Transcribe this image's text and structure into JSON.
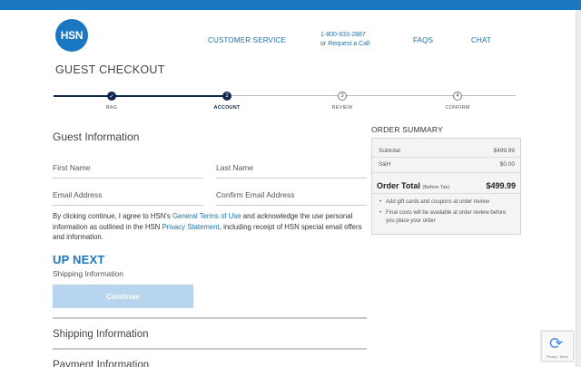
{
  "header": {
    "logo_text": "HSN",
    "customer_service": "CUSTOMER SERVICE",
    "phone_number": "1-800-933-2887",
    "phone_or": "or",
    "request_call": "Request a Call",
    "faqs": "FAQS",
    "chat": "CHAT"
  },
  "page_title": "GUEST CHECKOUT",
  "progress": {
    "steps": [
      {
        "label": "BAG",
        "marker": "✓",
        "state": "complete"
      },
      {
        "label": "ACCOUNT",
        "marker": "2",
        "state": "current"
      },
      {
        "label": "REVIEW",
        "marker": "3",
        "state": "upcoming"
      },
      {
        "label": "CONFIRM",
        "marker": "4",
        "state": "upcoming"
      }
    ]
  },
  "guest_info": {
    "title": "Guest Information",
    "first_name_placeholder": "First Name",
    "last_name_placeholder": "Last Name",
    "email_placeholder": "Email Address",
    "confirm_email_placeholder": "Confirm Email Address"
  },
  "consent": {
    "part1": "By clicking continue, I agree to HSN's ",
    "terms_link": "General Terms of Use",
    "part2": " and acknowledge the use personal information as outlined in the HSN ",
    "privacy_link": "Privacy Statement",
    "part3": ", including receipt of HSN special email offers and information."
  },
  "up_next": {
    "title": "UP NEXT",
    "subtitle": "Shipping Information",
    "button_label": "Continue"
  },
  "collapsed_sections": {
    "shipping": "Shipping Information",
    "payment": "Payment Information"
  },
  "order_summary": {
    "title": "ORDER SUMMARY",
    "subtotal_label": "Subtotal",
    "subtotal_value": "$499.99",
    "sh_label": "S&H",
    "sh_value": "$0.00",
    "total_label": "Order Total",
    "total_note": "(Before Tax)",
    "total_value": "$499.99",
    "notes": [
      "Add gift cards and coupons at order review",
      "Final costs will be available at order review before you place your order"
    ]
  },
  "colors": {
    "brand_blue": "#1a78c2",
    "progress_navy": "#0f2a4a",
    "disabled_button": "#b7d5ee"
  }
}
